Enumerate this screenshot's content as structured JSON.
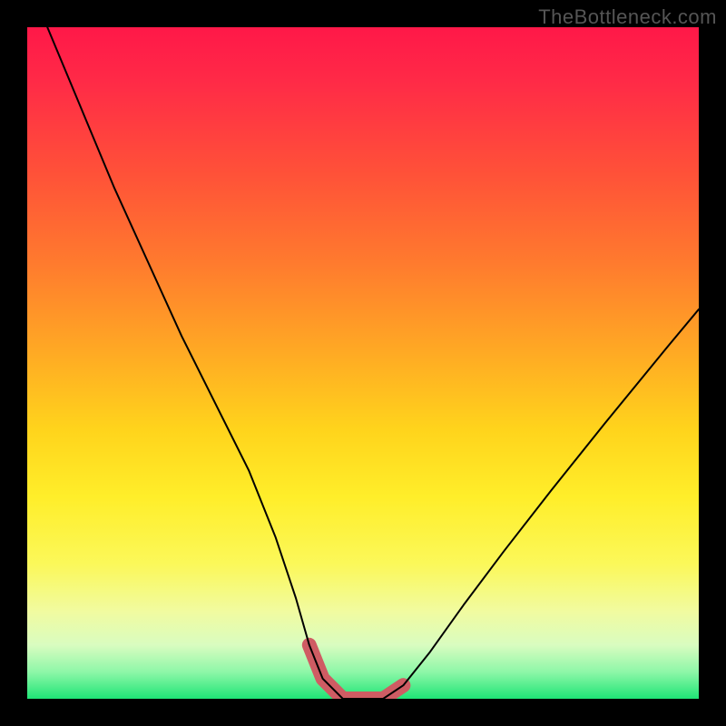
{
  "watermark": "TheBottleneck.com",
  "colors": {
    "frame": "#000000",
    "watermark_text": "#555555",
    "gradient_top": "#ff1848",
    "gradient_mid": "#ffd41c",
    "gradient_bottom": "#1fe576",
    "curve": "#000000",
    "flat_segment": "#cf5c63"
  },
  "chart_data": {
    "type": "line",
    "title": "",
    "xlabel": "",
    "ylabel": "",
    "xlim": [
      0,
      100
    ],
    "ylim": [
      0,
      100
    ],
    "grid": false,
    "legend_position": "none",
    "series": [
      {
        "name": "bottleneck-curve",
        "x": [
          3,
          8,
          13,
          18,
          23,
          28,
          33,
          37,
          40,
          42,
          44,
          47,
          50,
          53,
          56,
          60,
          65,
          71,
          78,
          86,
          95,
          100
        ],
        "y": [
          100,
          88,
          76,
          65,
          54,
          44,
          34,
          24,
          15,
          8,
          3,
          0,
          0,
          0,
          2,
          7,
          14,
          22,
          31,
          41,
          52,
          58
        ]
      }
    ],
    "annotations": [
      {
        "name": "optimal-flat-segment",
        "type": "path",
        "x": [
          42,
          44,
          47,
          50,
          53,
          56
        ],
        "y": [
          8,
          3,
          0,
          0,
          0,
          2
        ],
        "color": "#cf5c63",
        "stroke_width_px": 16
      }
    ],
    "background_gradient_stops": [
      {
        "pos": 0.0,
        "color": "#ff1848"
      },
      {
        "pos": 0.22,
        "color": "#ff5238"
      },
      {
        "pos": 0.48,
        "color": "#ffa824"
      },
      {
        "pos": 0.7,
        "color": "#ffee2a"
      },
      {
        "pos": 0.92,
        "color": "#d9fcc0"
      },
      {
        "pos": 1.0,
        "color": "#1fe576"
      }
    ]
  }
}
